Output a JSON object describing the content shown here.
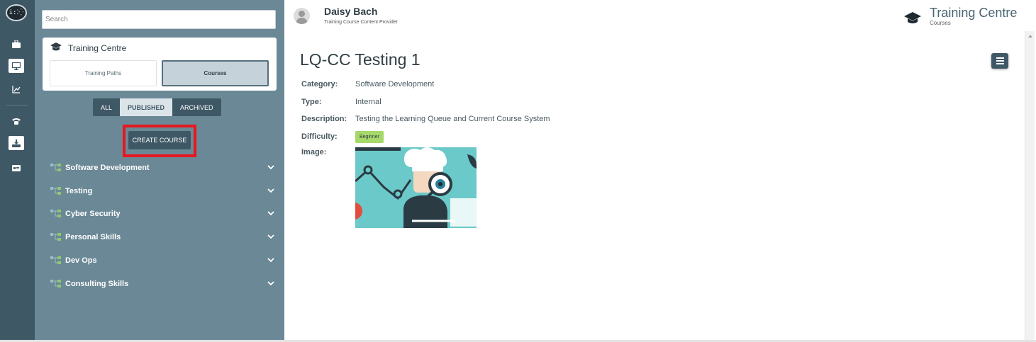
{
  "rail": {
    "logo_text": "i:⁚⁛",
    "icons": [
      "briefcase-icon",
      "monitor-icon",
      "chart-icon",
      "phone-icon",
      "download-icon",
      "card-icon"
    ],
    "colors": {
      "background": "#3e5866"
    }
  },
  "panel": {
    "search_placeholder": "Search",
    "training_centre_label": "Training Centre",
    "tabs": {
      "training_paths": "Training Paths",
      "courses": "Courses"
    },
    "filters": {
      "all": "ALL",
      "published": "PUBLISHED",
      "archived": "ARCHIVED"
    },
    "create_course_label": "CREATE COURSE",
    "categories": [
      {
        "label": "Software Development"
      },
      {
        "label": "Testing"
      },
      {
        "label": "Cyber Security"
      },
      {
        "label": "Personal Skills"
      },
      {
        "label": "Dev Ops"
      },
      {
        "label": "Consulting Skills"
      }
    ]
  },
  "header": {
    "user_name": "Daisy Bach",
    "user_role": "Training Course Content Provider",
    "brand_title": "Training Centre",
    "brand_subtitle": "Courses"
  },
  "course": {
    "title": "LQ-CC Testing 1",
    "fields": {
      "category_label": "Category:",
      "category_value": "Software Development",
      "type_label": "Type:",
      "type_value": "Internal",
      "description_label": "Description:",
      "description_value": "Testing the Learning Queue and Current Course System",
      "difficulty_label": "Difficulty:",
      "difficulty_value": "Beginner",
      "image_label": "Image:"
    }
  },
  "colors": {
    "panel": "#6b8896",
    "accent": "#3e5866",
    "highlight": "#e8161f",
    "badge": "#a6d86a"
  }
}
